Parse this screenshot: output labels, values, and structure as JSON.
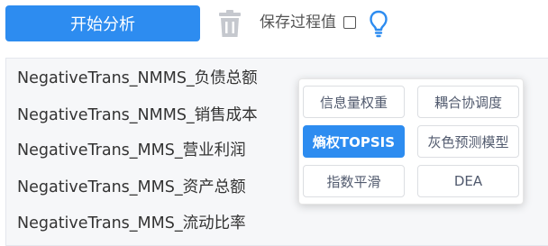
{
  "toolbar": {
    "start_label": "开始分析",
    "save_process_label": "保存过程值",
    "save_process_checked": false,
    "trash_icon": "trash-icon",
    "tip_icon": "lightbulb-icon",
    "accent_color": "#2d8cf0"
  },
  "variables": [
    "NegativeTrans_NMMS_负债总额",
    "NegativeTrans_NMMS_销售成本",
    "NegativeTrans_MMS_营业利润",
    "NegativeTrans_MMS_资产总额",
    "NegativeTrans_MMS_流动比率"
  ],
  "methods": {
    "active": "熵权TOPSIS",
    "items": [
      "信息量权重",
      "耦合协调度",
      "熵权TOPSIS",
      "灰色预测模型",
      "指数平滑",
      "DEA"
    ]
  }
}
